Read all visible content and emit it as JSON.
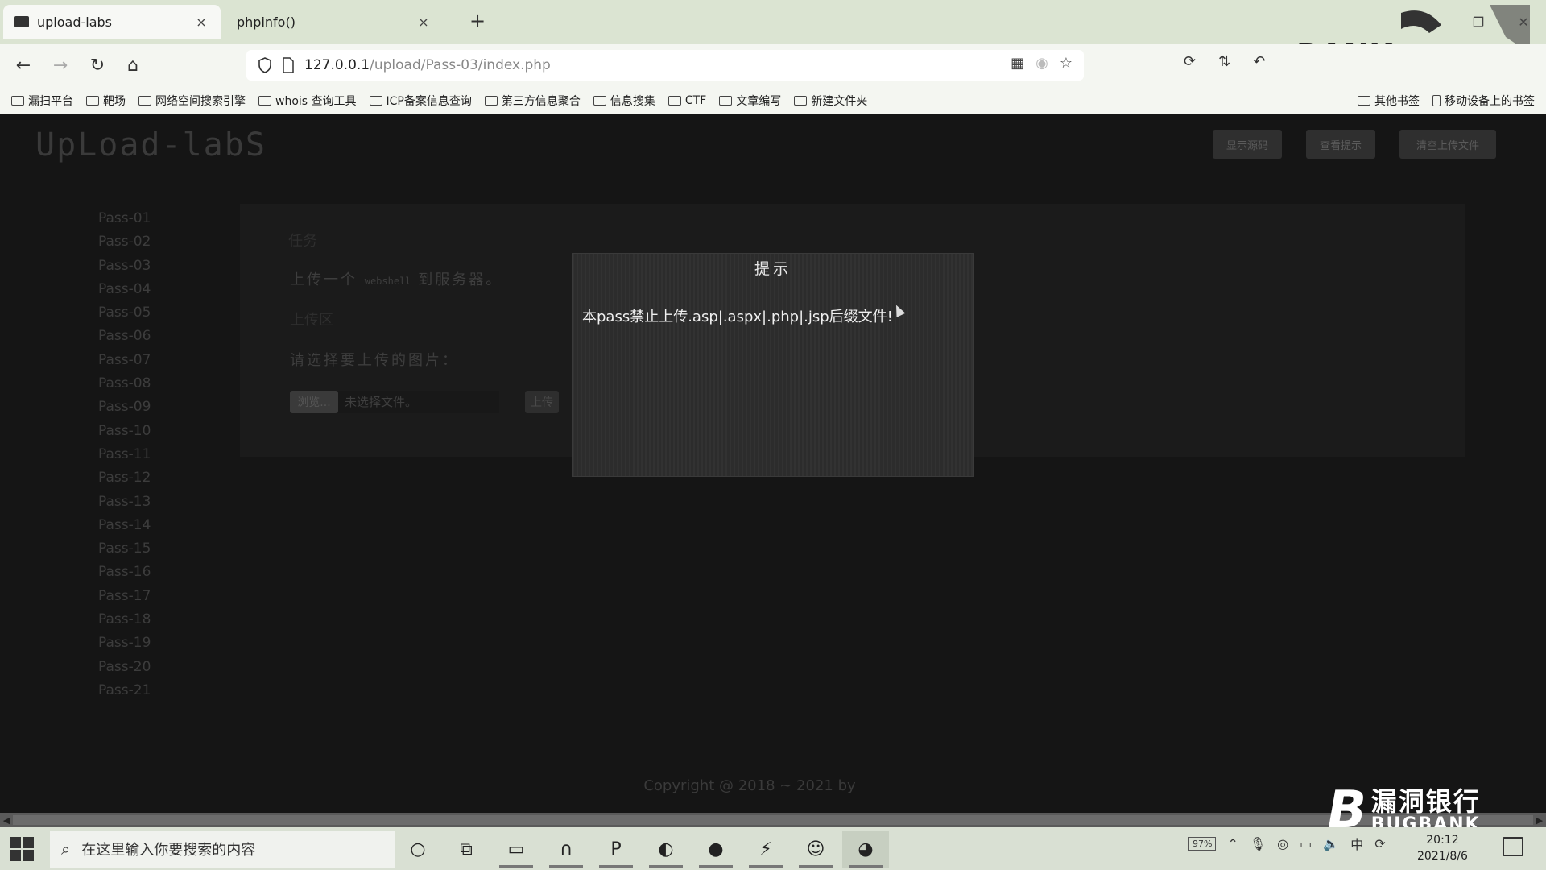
{
  "browser": {
    "tabs": [
      {
        "title": "upload-labs",
        "close": "×"
      },
      {
        "title": "phpinfo()",
        "close": "×"
      }
    ],
    "new_tab": "+",
    "window_controls": {
      "minimize": "–",
      "restore": "❐",
      "close": "✕"
    },
    "nav": {
      "back": "←",
      "forward": "→",
      "reload": "↻",
      "home": "⌂"
    },
    "url": {
      "host": "127.0.0.1",
      "path": "/upload/Pass-03/index.php"
    },
    "bookmarks": [
      "漏扫平台",
      "靶场",
      "网络空间搜索引擎",
      "whois 查询工具",
      "ICP备案信息查询",
      "第三方信息聚合",
      "信息搜集",
      "CTF",
      "文章编写",
      "新建文件夹"
    ],
    "bookmarks_right": [
      "其他书签",
      "移动设备上的书签"
    ]
  },
  "page": {
    "logo": "UpLoad-labS",
    "top_buttons": [
      "显示源码",
      "查看提示",
      "清空上传文件"
    ],
    "sidebar": [
      "Pass-01",
      "Pass-02",
      "Pass-03",
      "Pass-04",
      "Pass-05",
      "Pass-06",
      "Pass-07",
      "Pass-08",
      "Pass-09",
      "Pass-10",
      "Pass-11",
      "Pass-12",
      "Pass-13",
      "Pass-14",
      "Pass-15",
      "Pass-16",
      "Pass-17",
      "Pass-18",
      "Pass-19",
      "Pass-20",
      "Pass-21"
    ],
    "task": {
      "heading": "任务",
      "text_before": "上传一个",
      "text_code": "webshell",
      "text_after": "到服务器。"
    },
    "upload": {
      "heading": "上传区",
      "choose_label": "请选择要上传的图片：",
      "browse_label": "浏览...",
      "file_status": "未选择文件。",
      "submit_label": "上传"
    },
    "footer": "Copyright @ 2018 ~ 2021 by"
  },
  "modal": {
    "title": "提示",
    "message": "本pass禁止上传.asp|.aspx|.php|.jsp后缀文件!"
  },
  "watermark": {
    "cn": "漏洞银行",
    "en": "BUGBANK"
  },
  "taskbar": {
    "search_placeholder": "在这里输入你要搜索的内容",
    "battery": "97%",
    "time": "20:12",
    "date": "2021/8/6"
  },
  "colors": {
    "page_bg": "#151515",
    "modal_bg": "#2d2d2d",
    "chrome_bg": "#f4f6f1",
    "taskbar_bg": "#d9e0d3"
  }
}
